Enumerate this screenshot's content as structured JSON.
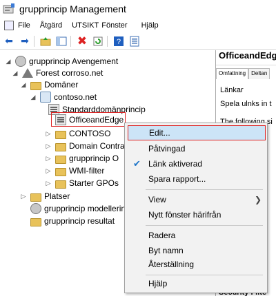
{
  "window": {
    "title": "grupprincip Management"
  },
  "menubar": {
    "items": [
      "File",
      "Åtgärd",
      "UTSIKT",
      "Fönster",
      "Hjälp"
    ]
  },
  "tree": {
    "root": "grupprincip Avengement",
    "forest": "Forest corroso.net",
    "domains": "Domäner",
    "domain": "contoso.net",
    "default_policy": "Standarddomänprincip",
    "selected_gpo": "OfficeandEdge",
    "contoso": "CONTOSO",
    "domain_controllers": "Domain Contra",
    "gp_objects": "grupprincip O",
    "wmi": "WMI-filter",
    "starter": "Starter GPOs",
    "sites": "Platser",
    "modeling": "grupprincip modellering",
    "results": "grupprincip resultat"
  },
  "right_pane": {
    "title": "OfficeandEdge",
    "tabs": [
      "Omfattning",
      "Deltan"
    ],
    "links_label": "Länkar",
    "links_text": "Spela ulnks in t",
    "following": "The following si",
    "security": "Security Filte"
  },
  "context_menu": {
    "edit": "Edit...",
    "enforced": "Påtvingad",
    "link_enabled": "Länk aktiverad",
    "save_report": "Spara rapport...",
    "view": "View",
    "new_window": "Nytt fönster härifrån",
    "delete": "Radera",
    "rename": "Byt namn",
    "refresh": "Återställning",
    "help": "Hjälp"
  },
  "colors": {
    "highlight_border": "#d22222",
    "hover_bg": "#cce4f7",
    "check": "#1a73c8"
  }
}
